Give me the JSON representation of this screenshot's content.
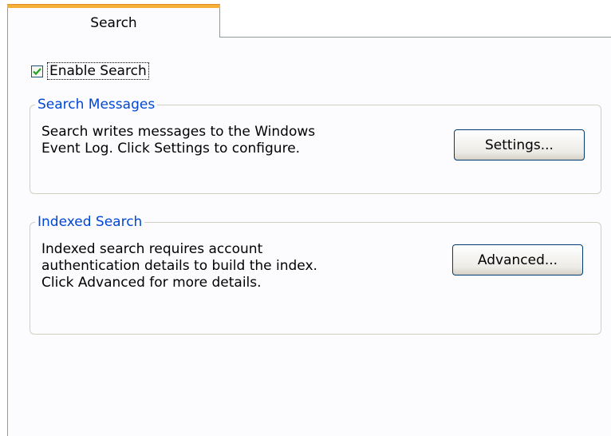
{
  "tab": {
    "label": "Search"
  },
  "enable_search": {
    "label": "Enable Search",
    "checked": true
  },
  "search_messages": {
    "legend": "Search Messages",
    "text_line1": "Search writes messages to the Windows",
    "text_line2": "Event Log. Click Settings to configure.",
    "button_label": "Settings..."
  },
  "indexed_search": {
    "legend": "Indexed Search",
    "text_line1": "Indexed search requires account",
    "text_line2": "authentication details to build the index.",
    "text_line3": "Click Advanced for more details.",
    "button_label": "Advanced..."
  },
  "colors": {
    "tab_highlight": "#f6b038",
    "legend_text": "#0046d5",
    "checkmark": "#21a121",
    "button_border": "#003c74"
  }
}
